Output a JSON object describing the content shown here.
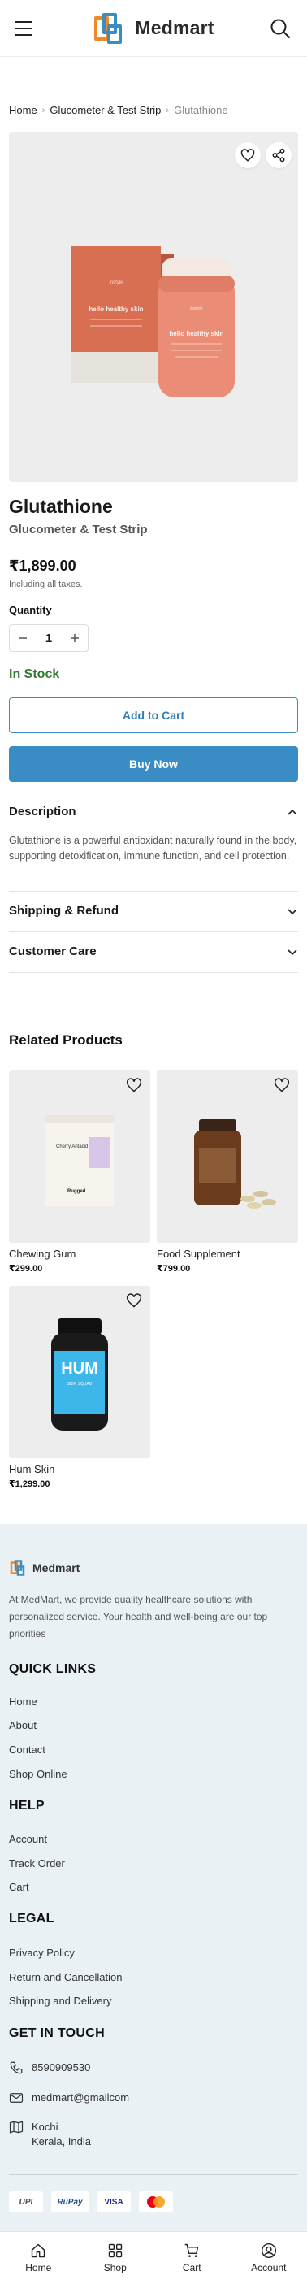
{
  "brand": {
    "name": "Medmart",
    "accent": "#3a8dc4",
    "logo_blue": "#3a8dc4",
    "logo_orange": "#f08a24"
  },
  "breadcrumb": {
    "home": "Home",
    "category": "Glucometer & Test Strip",
    "current": "Glutathione"
  },
  "product": {
    "title": "Glutathione",
    "category": "Glucometer & Test Strip",
    "price": "₹1,899.00",
    "tax_note": "Including all taxes.",
    "quantity_label": "Quantity",
    "quantity": "1",
    "stock": "In Stock",
    "add_to_cart": "Add to Cart",
    "buy_now": "Buy Now",
    "image": {
      "box_front_text": "hello healthy skin",
      "bottle_text": "hello healthy skin"
    }
  },
  "accordions": {
    "description": {
      "title": "Description",
      "text": "Glutathione is a powerful antioxidant naturally found in the body, supporting detoxification, immune function, and cell protection."
    },
    "shipping": {
      "title": "Shipping & Refund"
    },
    "care": {
      "title": "Customer Care"
    }
  },
  "related": {
    "title": "Related Products",
    "items": [
      {
        "name": "Chewing Gum",
        "price": "₹299.00",
        "pack_text": "Cherry Antacid",
        "pack_brand": "Rugged"
      },
      {
        "name": "Food Supplement",
        "price": "₹799.00"
      },
      {
        "name": "Hum Skin",
        "price": "₹1,299.00",
        "bottle_text": "HUM",
        "bottle_sub": "SKIN SQUAD"
      }
    ]
  },
  "footer": {
    "brand": "Medmart",
    "about": "At MedMart, we provide quality healthcare solutions with personalized service. Your health and well-being are our top priorities",
    "quick_links": {
      "title": "QUICK LINKS",
      "items": [
        "Home",
        "About",
        "Contact",
        "Shop Online"
      ]
    },
    "help": {
      "title": "HELP",
      "items": [
        "Account",
        "Track Order",
        "Cart"
      ]
    },
    "legal": {
      "title": "LEGAL",
      "items": [
        "Privacy Policy",
        "Return and Cancellation",
        "Shipping and Delivery"
      ]
    },
    "contact": {
      "title": "GET IN TOUCH",
      "phone": "8590909530",
      "email": "medmart@gmailcom",
      "address_line1": "Kochi",
      "address_line2": "Kerala, India"
    },
    "payments": [
      "UPI",
      "RuPay",
      "VISA",
      "Mastercard"
    ]
  },
  "bottom_nav": {
    "home": "Home",
    "shop": "Shop",
    "cart": "Cart",
    "account": "Account"
  }
}
